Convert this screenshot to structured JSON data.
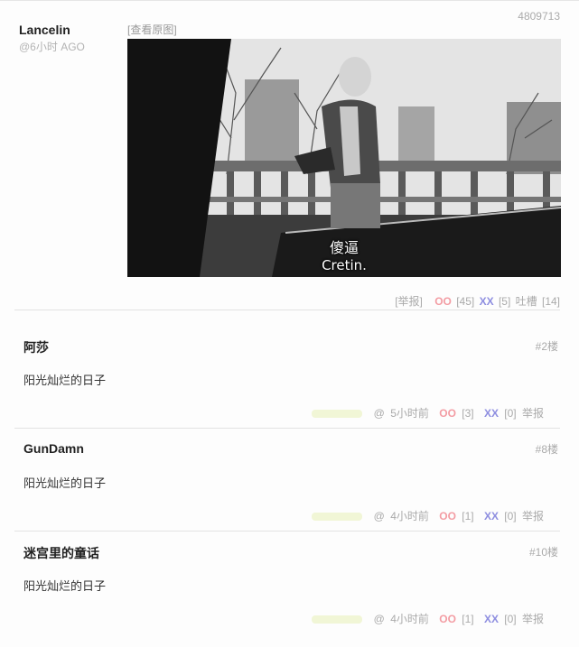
{
  "post": {
    "id": "4809713",
    "author": "Lancelin",
    "time": "@6小时 AGO",
    "view_original": "[查看原图]",
    "subtitle_cn": "傻逼",
    "subtitle_en": "Cretin.",
    "report": "[举报]",
    "oo_label": "OO",
    "oo_count": "[45]",
    "xx_label": "XX",
    "xx_count": "[5]",
    "tucao_label": "吐槽",
    "tucao_count": "[14]"
  },
  "comments": [
    {
      "name": "阿莎",
      "floor": "#2楼",
      "text": "阳光灿烂的日子",
      "at": "@",
      "time": "5小时前",
      "oo": "OO",
      "oo_count": "[3]",
      "xx": "XX",
      "xx_count": "[0]",
      "report": "举报"
    },
    {
      "name": "GunDamn",
      "floor": "#8楼",
      "text": "阳光灿烂的日子",
      "at": "@",
      "time": "4小时前",
      "oo": "OO",
      "oo_count": "[1]",
      "xx": "XX",
      "xx_count": "[0]",
      "report": "举报"
    },
    {
      "name": "迷宫里的童话",
      "floor": "#10楼",
      "text": "阳光灿烂的日子",
      "at": "@",
      "time": "4小时前",
      "oo": "OO",
      "oo_count": "[1]",
      "xx": "XX",
      "xx_count": "[0]",
      "report": "举报"
    }
  ],
  "colors": {
    "oo": "#f39ca3",
    "xx": "#8e8ee0",
    "muted": "#aaaaaa"
  }
}
